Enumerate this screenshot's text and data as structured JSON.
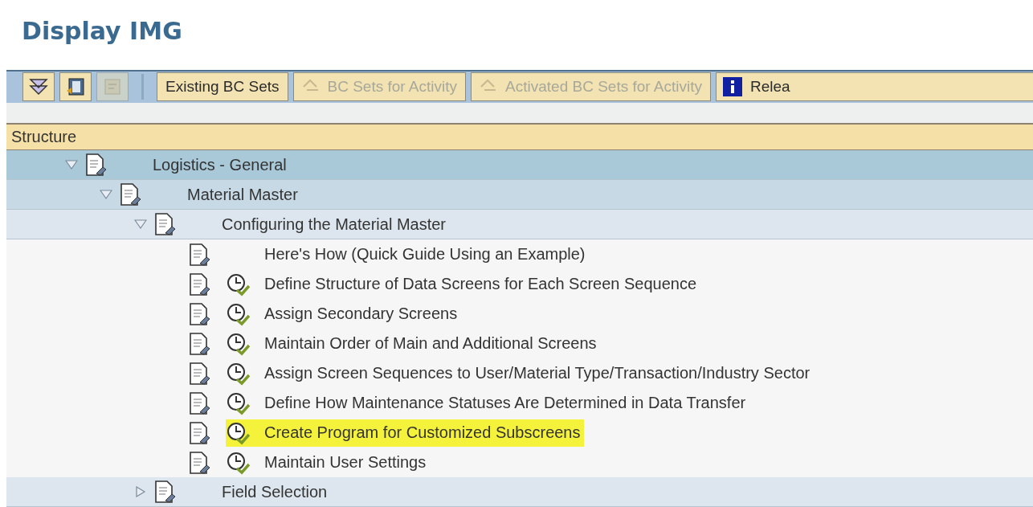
{
  "window": {
    "title": "Display IMG"
  },
  "toolbar": {
    "icon_buttons": [
      {
        "kind": "expand",
        "disabled": false
      },
      {
        "kind": "document",
        "disabled": false
      },
      {
        "kind": "collapse",
        "disabled": true
      }
    ],
    "buttons": [
      {
        "label": "Existing BC Sets",
        "icon": false,
        "disabled": false
      },
      {
        "label": "BC Sets for Activity",
        "icon": true,
        "disabled": true
      },
      {
        "label": "Activated BC Sets for Activity",
        "icon": true,
        "disabled": true
      }
    ],
    "info_button": {
      "label": "Relea"
    }
  },
  "tree": {
    "header": "Structure",
    "items": [
      {
        "label": "Logistics - General",
        "kind": "folder",
        "expanded": true,
        "children": [
          {
            "label": "Material Master",
            "kind": "folder",
            "expanded": true,
            "children": [
              {
                "label": "Configuring the Material Master",
                "kind": "folder",
                "expanded": true,
                "children": [
                  {
                    "label": "Here's How (Quick Guide Using an Example)",
                    "kind": "document",
                    "highlighted": false
                  },
                  {
                    "label": "Define Structure of Data Screens for Each Screen Sequence",
                    "kind": "activity",
                    "highlighted": false
                  },
                  {
                    "label": "Assign Secondary Screens",
                    "kind": "activity",
                    "highlighted": false
                  },
                  {
                    "label": "Maintain Order of Main and Additional Screens",
                    "kind": "activity",
                    "highlighted": false
                  },
                  {
                    "label": "Assign Screen Sequences to User/Material Type/Transaction/Industry Sector",
                    "kind": "activity",
                    "highlighted": false
                  },
                  {
                    "label": "Define How Maintenance Statuses Are Determined in Data Transfer",
                    "kind": "activity",
                    "highlighted": false
                  },
                  {
                    "label": "Create Program for Customized Subscreens",
                    "kind": "activity",
                    "highlighted": true
                  },
                  {
                    "label": "Maintain User Settings",
                    "kind": "activity",
                    "highlighted": false
                  }
                ]
              },
              {
                "label": "Field Selection",
                "kind": "folder",
                "expanded": false
              }
            ]
          }
        ]
      }
    ]
  }
}
